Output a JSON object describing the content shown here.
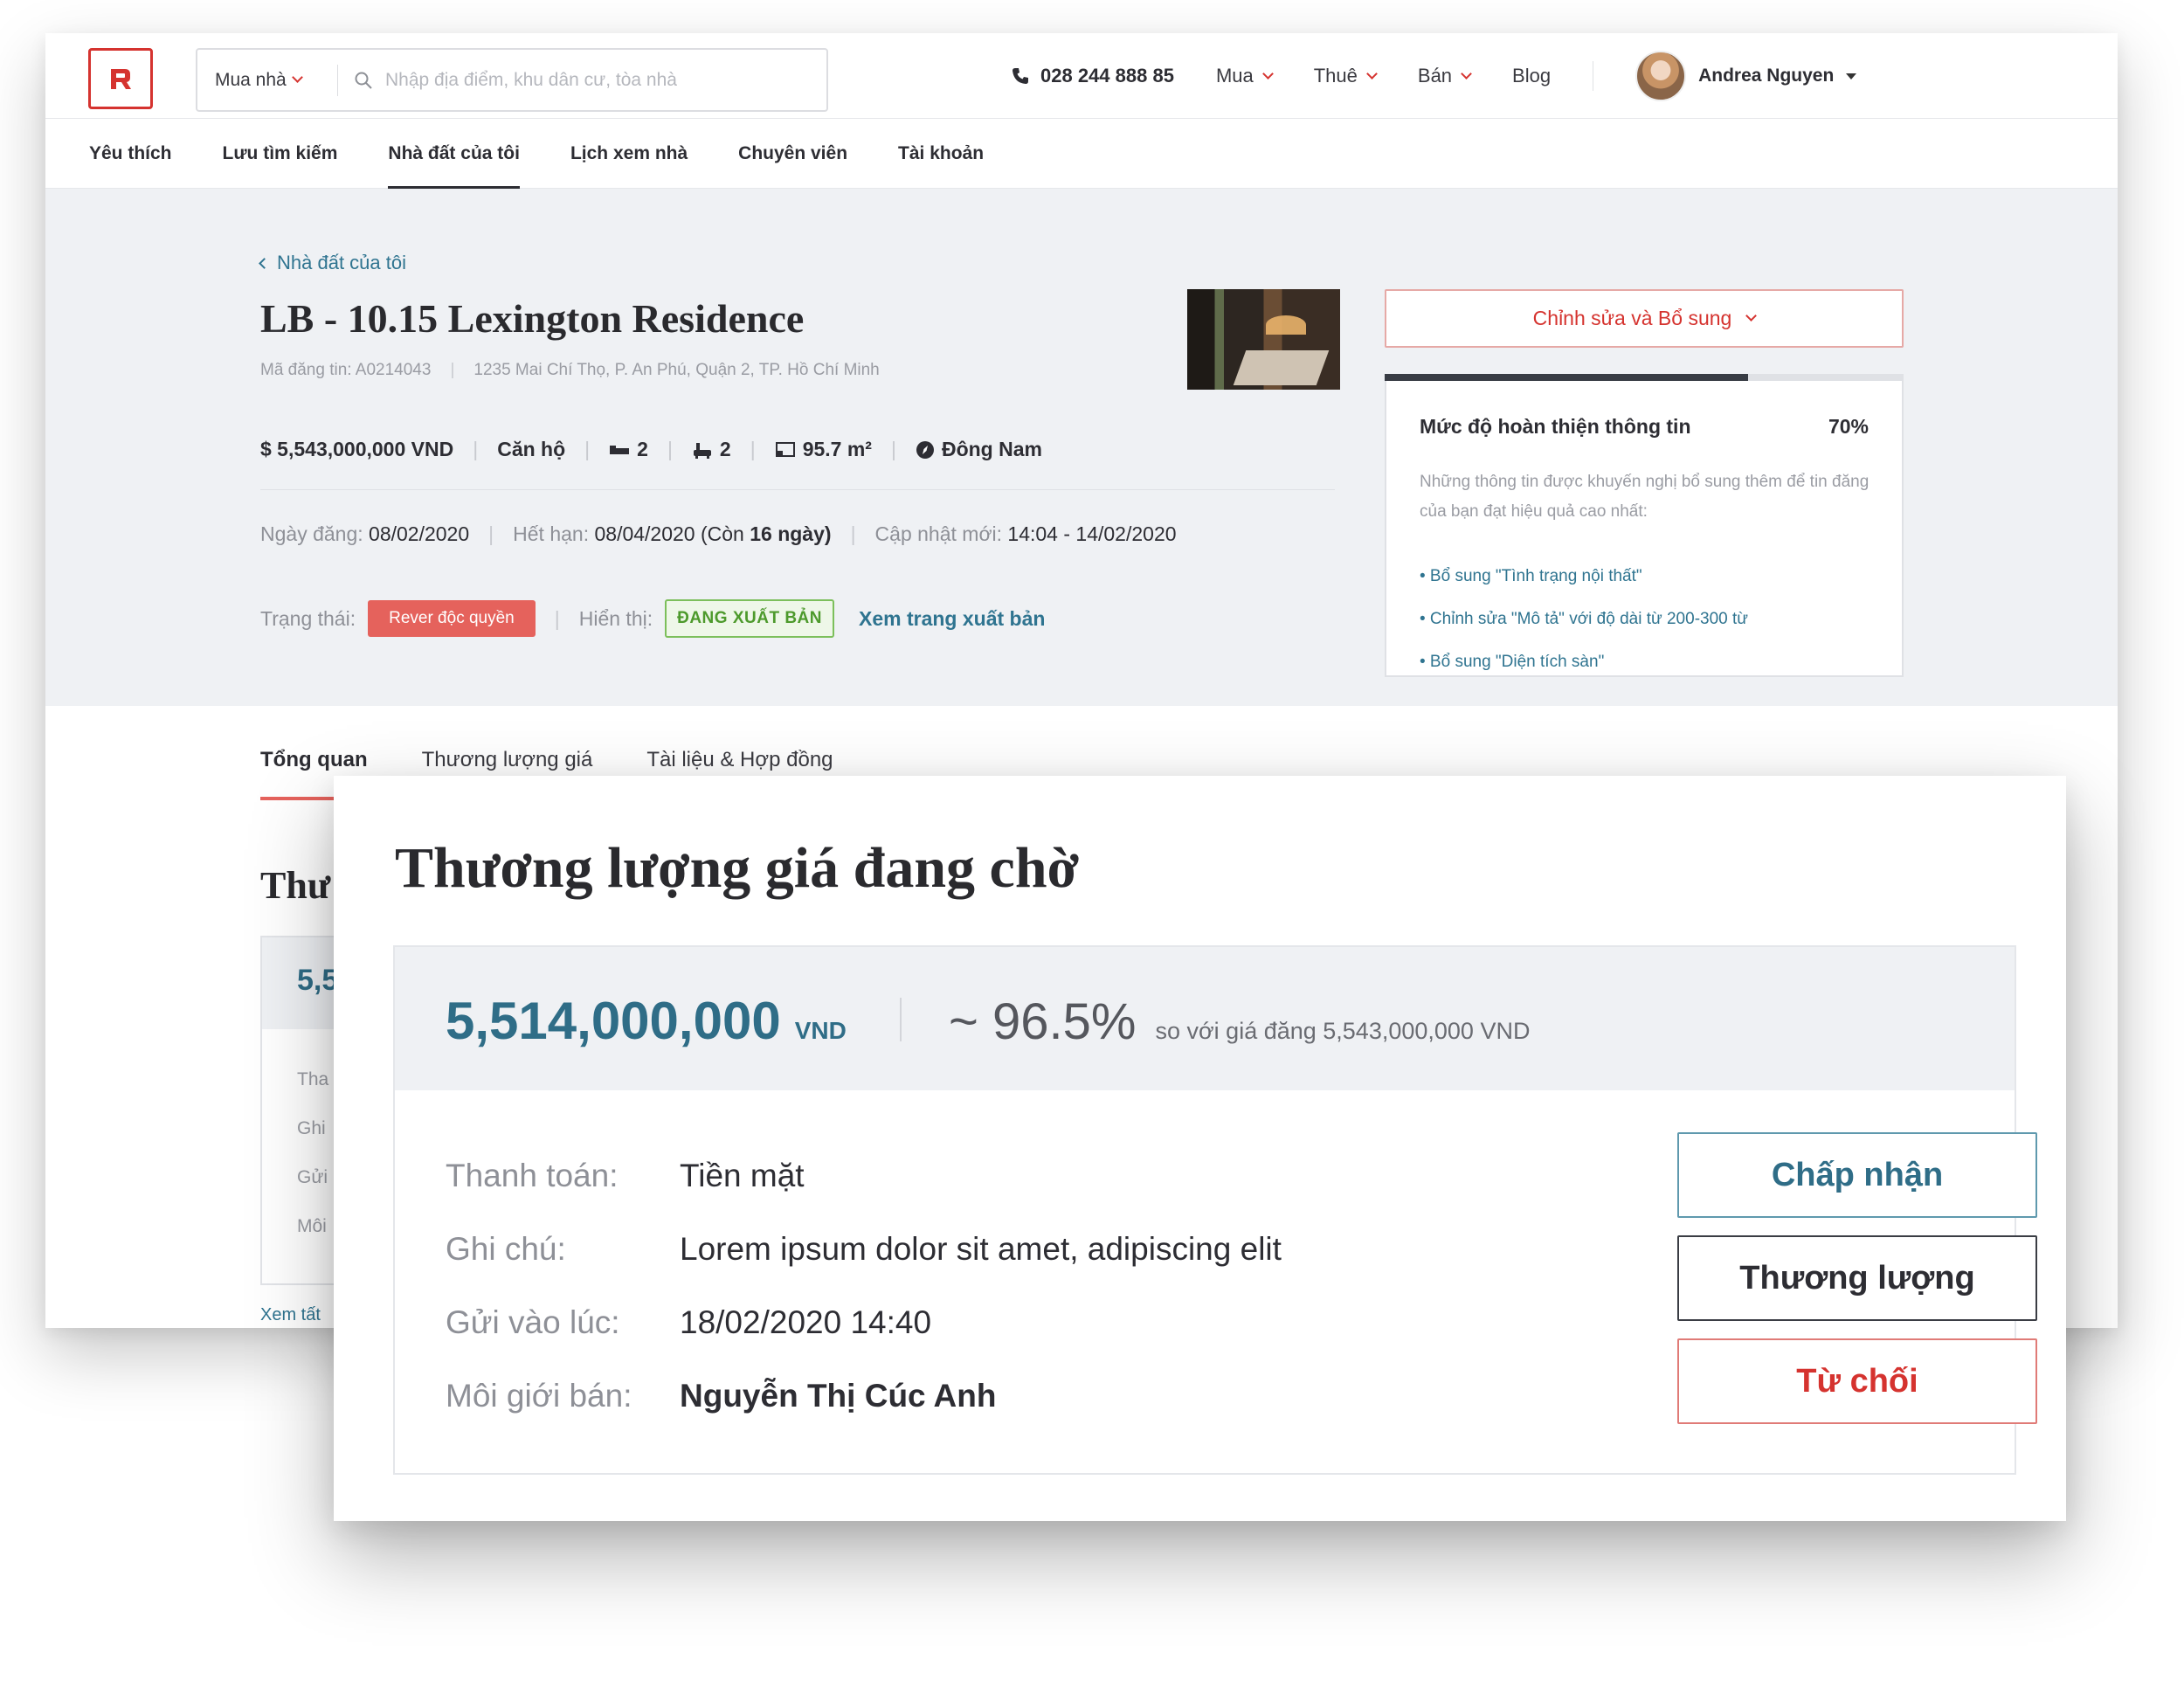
{
  "header": {
    "search_mode": "Mua nhà",
    "search_placeholder": "Nhập địa điểm, khu dân cư, tòa nhà",
    "phone": "028 244 888 85",
    "nav": [
      "Mua",
      "Thuê",
      "Bán"
    ],
    "blog": "Blog",
    "user_name": "Andrea Nguyen"
  },
  "subnav": {
    "items": [
      "Yêu thích",
      "Lưu tìm kiếm",
      "Nhà đất  của tôi",
      "Lịch xem nhà",
      "Chuyên viên",
      "Tài khoản"
    ],
    "active_index": 2
  },
  "listing": {
    "back_link": "Nhà đất của tôi",
    "title": "LB - 10.15 Lexington Residence",
    "code": "Mã đăng tin: A0214043",
    "address": "1235 Mai Chí Thọ, P. An Phú, Quận 2, TP. Hồ Chí Minh",
    "price": "$ 5,543,000,000 VND",
    "type": "Căn hộ",
    "beds": "2",
    "baths": "2",
    "area": "95.7 m²",
    "direction": "Đông Nam",
    "posted_label": "Ngày đăng:",
    "posted_date": "08/02/2020",
    "expiry_label": "Hết hạn:",
    "expiry_date": "08/04/2020 (Còn",
    "expiry_remaining": "16 ngày)",
    "updated_label": "Cập nhật mới:",
    "updated_value": "14:04 - 14/02/2020",
    "status_label": "Trạng thái:",
    "status_badge": "Rever độc quyền",
    "display_label": "Hiển thị:",
    "display_badge": "ĐANG XUẤT BẢN",
    "view_published": "Xem trang xuất bản"
  },
  "edit_button": "Chỉnh sửa và Bổ sung",
  "completeness": {
    "title": "Mức độ hoàn thiện thông tin",
    "percent_label": "70%",
    "percent": 70,
    "description": "Những thông tin được khuyến nghị bổ sung thêm để tin đăng của bạn đạt hiệu quả cao nhất:",
    "suggestions": [
      "• Bổ sung \"Tình trạng nội thất\"",
      "• Chỉnh sửa \"Mô tả\" với độ dài từ 200-300 từ",
      "• Bổ sung \"Diện tích sàn\""
    ]
  },
  "tabs": [
    "Tổng quan",
    "Thương lượng giá",
    "Tài liệu & Hợp đồng"
  ],
  "peek": {
    "title": "Thư",
    "amount": "5,5",
    "lines": [
      "Tha",
      "Ghi",
      "Gửi",
      "Môi"
    ],
    "link": "Xem tất"
  },
  "offer": {
    "title": "Thương lượng giá đang chờ",
    "amount": "5,514,000,000",
    "currency": "VND",
    "percent": "~ 96.5%",
    "compare": "so với giá đăng 5,543,000,000 VND",
    "payment_label": "Thanh toán:",
    "payment_value": "Tiền mặt",
    "note_label": "Ghi chú:",
    "note_value": "Lorem ipsum dolor sit amet, adipiscing elit",
    "sent_label": "Gửi vào lúc:",
    "sent_value": "18/02/2020  14:40",
    "agent_label": "Môi giới bán:",
    "agent_value": "Nguyễn Thị Cúc Anh",
    "accept": "Chấp nhận",
    "negotiate": "Thương lượng",
    "reject": "Từ chối"
  },
  "colors": {
    "brand_red": "#d5332f",
    "teal": "#2f6d87",
    "status_red": "#e5625c",
    "published_green": "#4d9a2c"
  }
}
